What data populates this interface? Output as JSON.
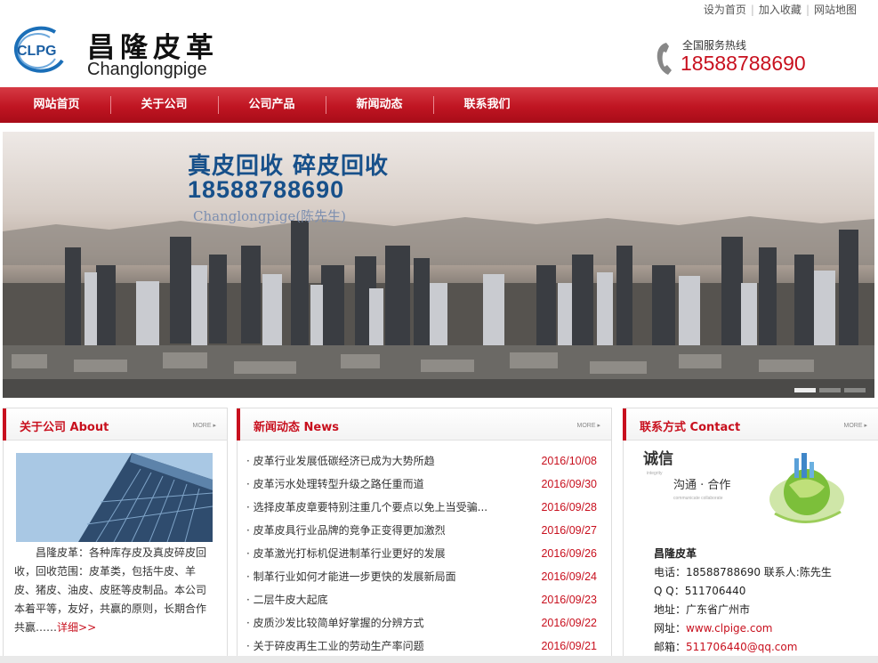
{
  "toplinks": {
    "home": "设为首页",
    "favorite": "加入收藏",
    "sitemap": "网站地图",
    "sep": "|"
  },
  "brand": {
    "logo_mark": "CLPG",
    "name_cn": "昌隆皮革",
    "name_en": "Changlongpige"
  },
  "hotline": {
    "label": "全国服务热线",
    "number": "18588788690"
  },
  "nav": [
    "网站首页",
    "关于公司",
    "公司产品",
    "新闻动态",
    "联系我们"
  ],
  "banner": {
    "line1": "真皮回收 碎皮回收",
    "line2": "18588788690",
    "line3": "Changlongpige(陈先生)",
    "slides": 4,
    "active_slide": 1
  },
  "about": {
    "title": "关于公司 About",
    "more": "MORE ▸",
    "text": "昌隆皮革：各种库存皮及真皮碎皮回收，回收范围：皮革类，包括牛皮、羊皮、猪皮、油皮、皮胚等皮制品。本公司本着平等，友好，共赢的原则，长期合作共赢……",
    "detail_link": "详细>>"
  },
  "news": {
    "title": "新闻动态 News",
    "more": "MORE ▸",
    "items": [
      {
        "title": "· 皮革行业发展低碳经济已成为大势所趋",
        "date": "2016/10/08"
      },
      {
        "title": "· 皮革污水处理转型升级之路任重而道",
        "date": "2016/09/30"
      },
      {
        "title": "· 选择皮革皮章要特别注重几个要点以免上当受骗...",
        "date": "2016/09/28"
      },
      {
        "title": "· 皮革皮具行业品牌的竞争正变得更加激烈",
        "date": "2016/09/27"
      },
      {
        "title": "· 皮革激光打标机促进制革行业更好的发展",
        "date": "2016/09/26"
      },
      {
        "title": "· 制革行业如何才能进一步更快的发展新局面",
        "date": "2016/09/24"
      },
      {
        "title": "· 二层牛皮大起底",
        "date": "2016/09/23"
      },
      {
        "title": "· 皮质沙发比较简单好掌握的分辨方式",
        "date": "2016/09/22"
      },
      {
        "title": "· 关于碎皮再生工业的劳动生产率问题",
        "date": "2016/09/21"
      }
    ]
  },
  "contact": {
    "title": "联系方式 Contact",
    "more": "MORE ▸",
    "img_word1": "诚信",
    "img_word2": "沟通 · 合作",
    "img_small1": "integrity",
    "img_small2": "communicate   collaborate",
    "company": "昌隆皮革",
    "phone_line": "电话：18588788690 联系人:陈先生",
    "qq_line": "Q Q：511706440",
    "address_line": "地址：广东省广州市",
    "web_label": "网址：",
    "web": "www.clpige.com",
    "mail_label": "邮箱：",
    "mail": "511706440@qq.com"
  },
  "colors": {
    "brand_red": "#c8101e",
    "banner_blue": "#17508a"
  }
}
